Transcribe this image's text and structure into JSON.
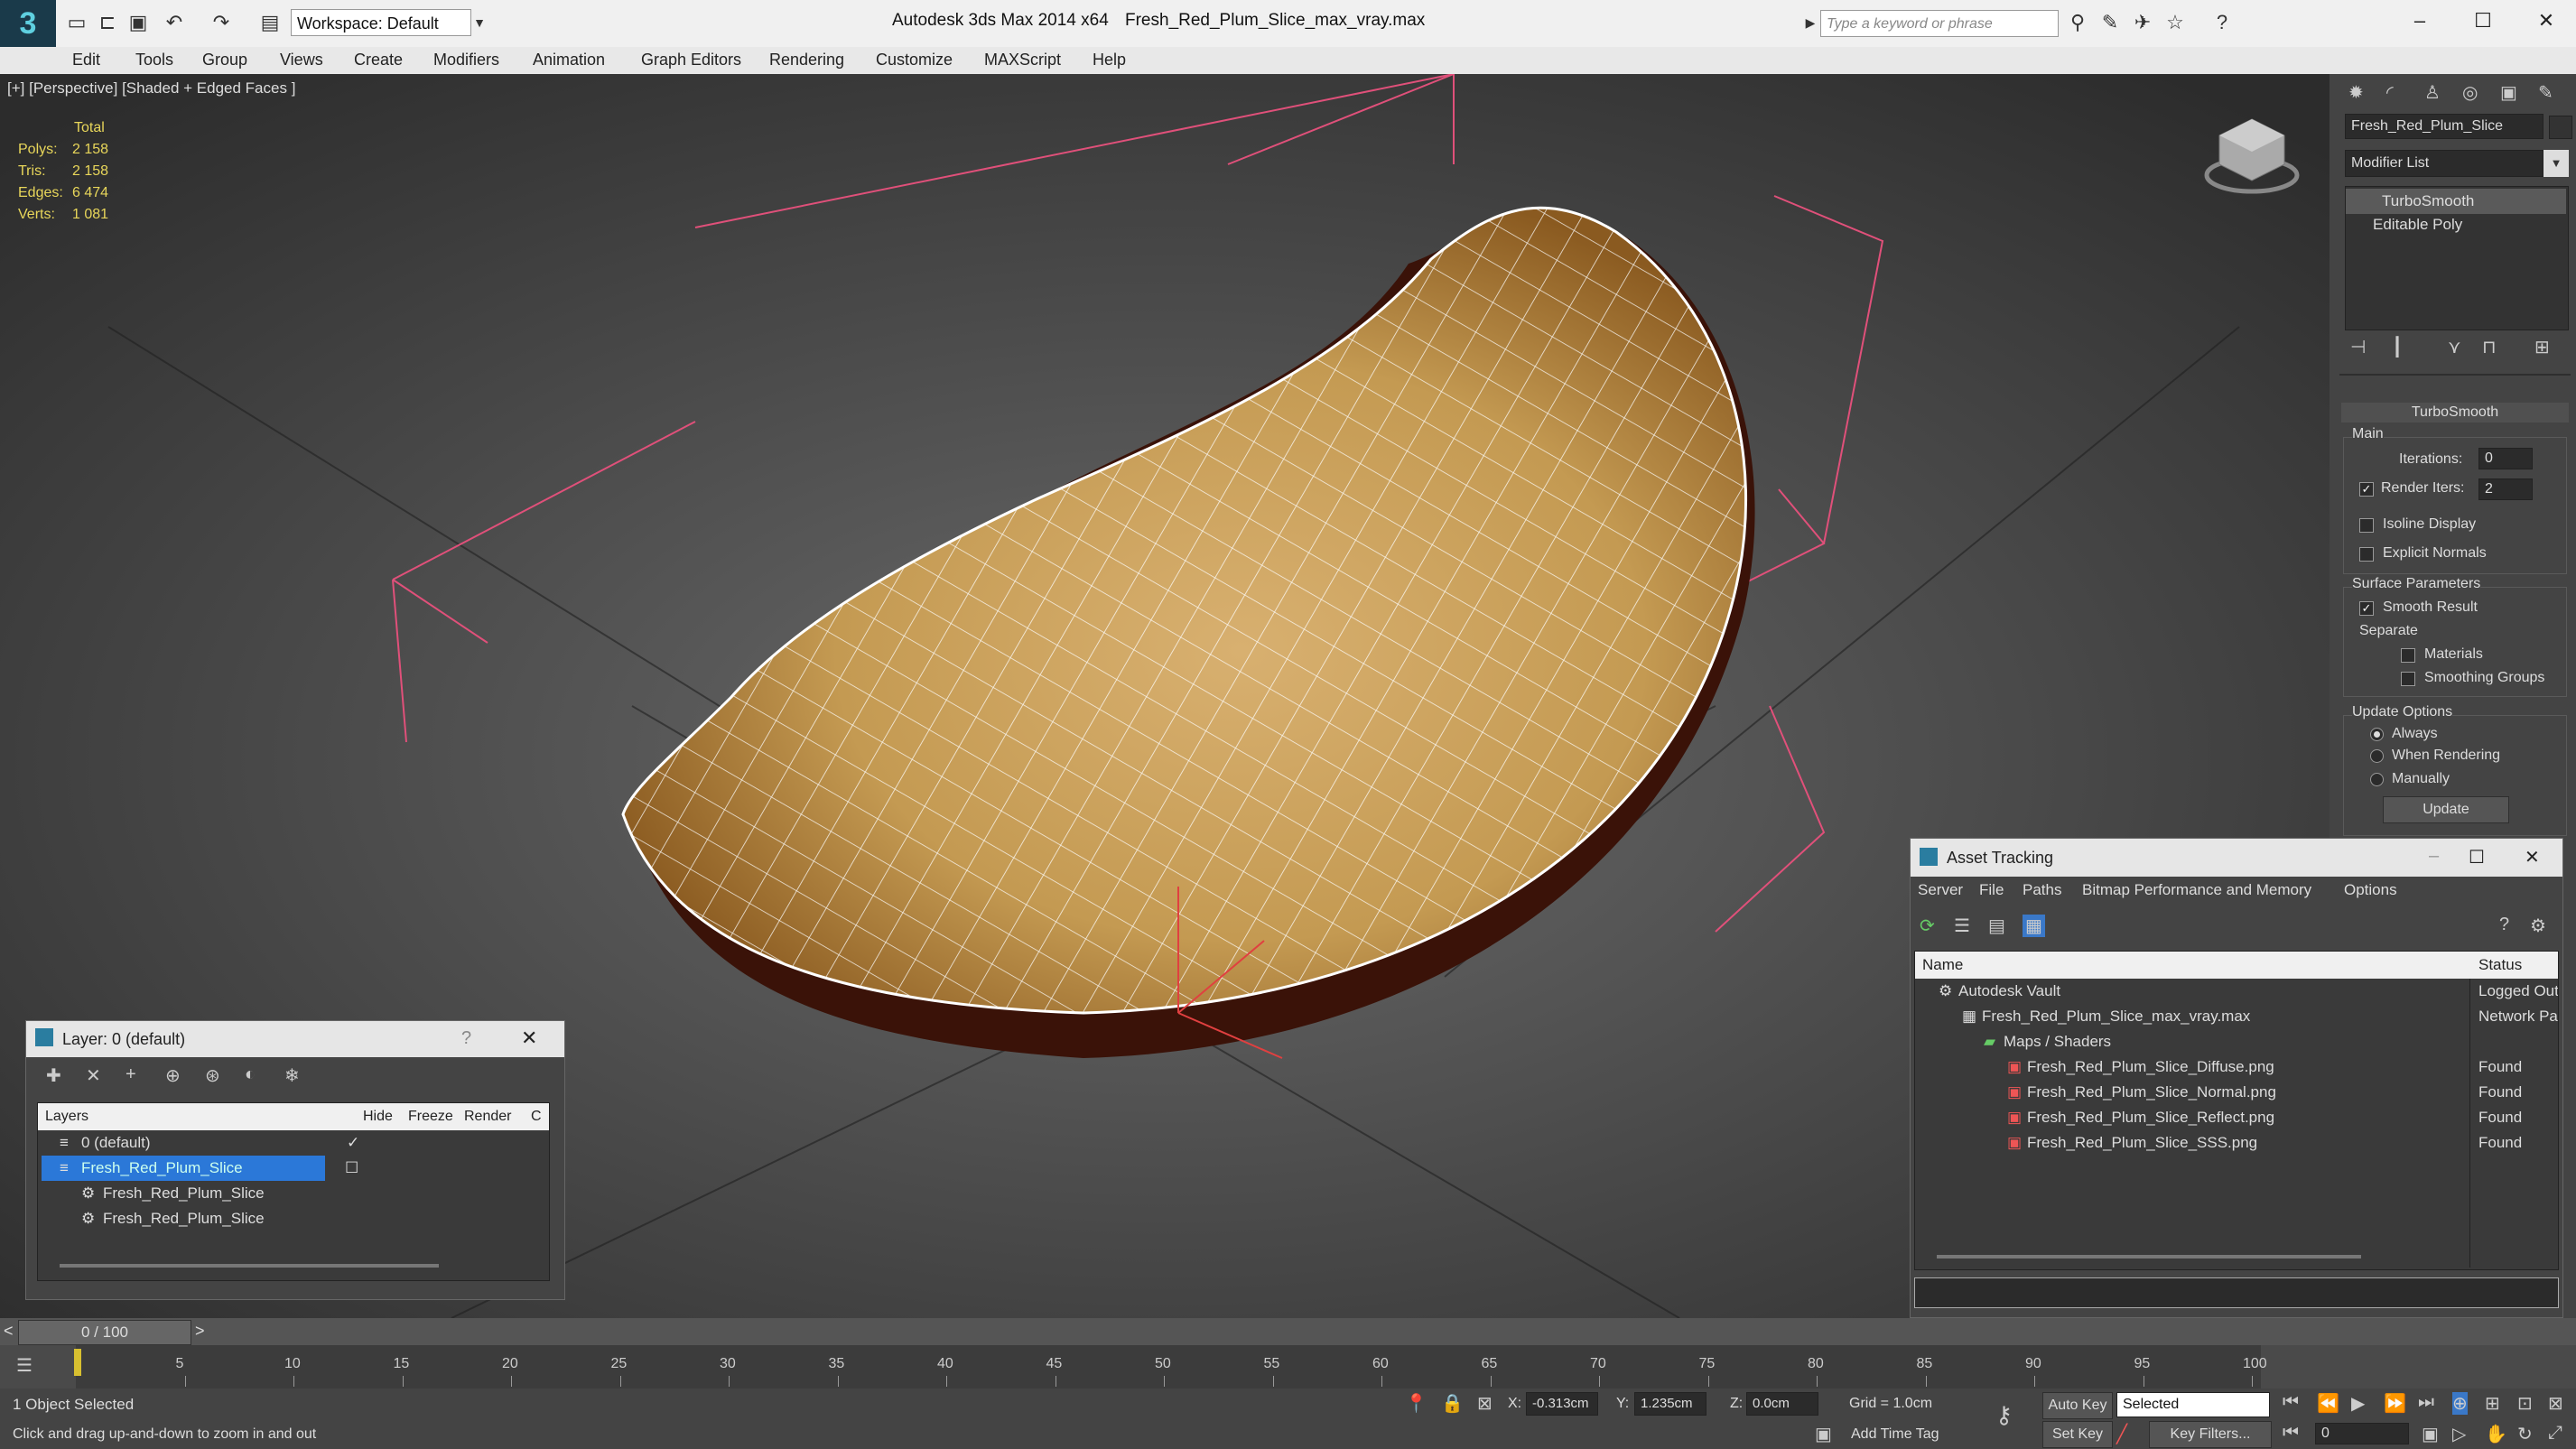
{
  "app": {
    "title": "Autodesk 3ds Max  2014 x64",
    "file": "Fresh_Red_Plum_Slice_max_vray.max",
    "workspace": "Workspace: Default",
    "search_placeholder": "Type a keyword or phrase"
  },
  "menu": [
    "Edit",
    "Tools",
    "Group",
    "Views",
    "Create",
    "Modifiers",
    "Animation",
    "Graph Editors",
    "Rendering",
    "Customize",
    "MAXScript",
    "Help"
  ],
  "viewport": {
    "label": "[+] [Perspective] [Shaded + Edged Faces ]",
    "stats": {
      "total_label": "Total",
      "polys_label": "Polys:",
      "polys": "2 158",
      "tris_label": "Tris:",
      "tris": "2 158",
      "edges_label": "Edges:",
      "edges": "6 474",
      "verts_label": "Verts:",
      "verts": "1 081"
    }
  },
  "command_panel": {
    "object_name": "Fresh_Red_Plum_Slice",
    "modifier_list": "Modifier List",
    "stack": [
      "TurboSmooth",
      "Editable Poly"
    ],
    "rollout_title": "TurboSmooth",
    "main_label": "Main",
    "iterations_label": "Iterations:",
    "iterations": "0",
    "render_iters_label": "Render Iters:",
    "render_iters": "2",
    "isoline_label": "Isoline Display",
    "explicit_label": "Explicit Normals",
    "surface_label": "Surface Parameters",
    "smooth_result_label": "Smooth Result",
    "separate_label": "Separate",
    "materials_label": "Materials",
    "smoothing_groups_label": "Smoothing Groups",
    "update_options_label": "Update Options",
    "always_label": "Always",
    "when_rendering_label": "When Rendering",
    "manually_label": "Manually",
    "update_button": "Update"
  },
  "layer_dialog": {
    "title": "Layer: 0 (default)",
    "help": "?",
    "columns": [
      "Layers",
      "Hide",
      "Freeze",
      "Render",
      "C"
    ],
    "rows": [
      {
        "name": "0 (default)"
      },
      {
        "name": "Fresh_Red_Plum_Slice"
      },
      {
        "name": "Fresh_Red_Plum_Slice"
      },
      {
        "name": "Fresh_Red_Plum_Slice"
      }
    ]
  },
  "asset_tracking": {
    "title": "Asset Tracking",
    "menu": [
      "Server",
      "File",
      "Paths",
      "Bitmap Performance and Memory",
      "Options"
    ],
    "col_name": "Name",
    "col_status": "Status",
    "rows": [
      {
        "name": "Autodesk Vault",
        "status": "Logged Out"
      },
      {
        "name": "Fresh_Red_Plum_Slice_max_vray.max",
        "status": "Network Pa"
      },
      {
        "name": "Maps / Shaders",
        "status": ""
      },
      {
        "name": "Fresh_Red_Plum_Slice_Diffuse.png",
        "status": "Found"
      },
      {
        "name": "Fresh_Red_Plum_Slice_Normal.png",
        "status": "Found"
      },
      {
        "name": "Fresh_Red_Plum_Slice_Reflect.png",
        "status": "Found"
      },
      {
        "name": "Fresh_Red_Plum_Slice_SSS.png",
        "status": "Found"
      }
    ]
  },
  "timeline": {
    "frame_display": "0 / 100",
    "prev": "<",
    "next": ">",
    "ticks": [
      "5",
      "10",
      "15",
      "20",
      "25",
      "30",
      "35",
      "40",
      "45",
      "50",
      "55",
      "60",
      "65",
      "70",
      "75",
      "80",
      "85",
      "90",
      "95",
      "100"
    ]
  },
  "status": {
    "selection": "1 Object Selected",
    "prompt": "Click and drag up-and-down to zoom in and out",
    "x_label": "X:",
    "x": "-0.313cm",
    "y_label": "Y:",
    "y": "1.235cm",
    "z_label": "Z:",
    "z": "0.0cm",
    "grid": "Grid = 1.0cm",
    "auto_key": "Auto Key",
    "selected": "Selected",
    "set_key": "Set Key",
    "key_filters": "Key Filters...",
    "add_time_tag": "Add Time Tag",
    "frame": "0"
  }
}
